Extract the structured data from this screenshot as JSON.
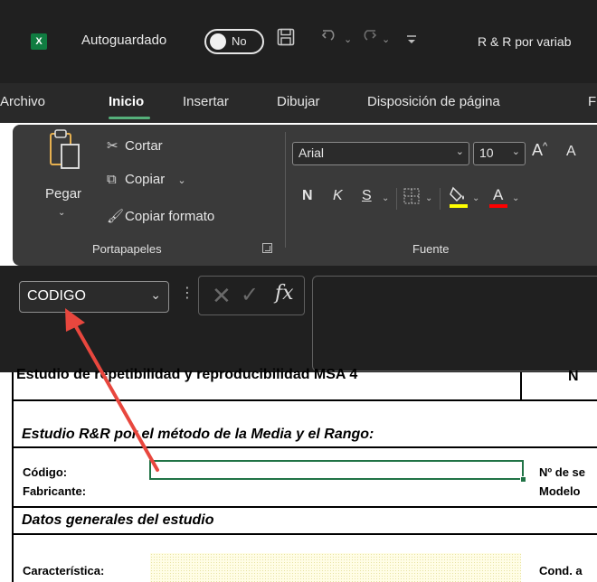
{
  "titlebar": {
    "app_icon": "X",
    "autosave_label": "Autoguardado",
    "autosave_state": "No",
    "doc_title": "R & R por variab"
  },
  "tabs": [
    "Archivo",
    "Inicio",
    "Insertar",
    "Dibujar",
    "Disposición de página",
    "F"
  ],
  "ribbon": {
    "clipboard": {
      "paste_label": "Pegar",
      "cut_label": "Cortar",
      "copy_label": "Copiar",
      "format_painter_label": "Copiar formato",
      "group_label": "Portapapeles"
    },
    "font": {
      "font_name": "Arial",
      "font_size": "10",
      "bold_label": "N",
      "italic_label": "K",
      "underline_label": "S",
      "group_label": "Fuente",
      "highlight_color": "#ffff00",
      "font_color": "#ff0000"
    }
  },
  "formula_bar": {
    "name_box": "CODIGO",
    "fx_label": "fx",
    "value": ""
  },
  "sheet": {
    "title": "Estudio de repetibilidad y reproducibilidad MSA 4",
    "title_right": "N",
    "section1": "Estudio R&R por el método de la Media y el Rango:",
    "codigo_label": "Código:",
    "fabricante_label": "Fabricante:",
    "serie_label": "Nº de se",
    "modelo_label": "Modelo",
    "section2": "Datos generales del estudio",
    "caracteristica_label": "Característica:",
    "cond_label": "Cond. a"
  },
  "annotation": {
    "arrow_color": "#e8473e"
  }
}
